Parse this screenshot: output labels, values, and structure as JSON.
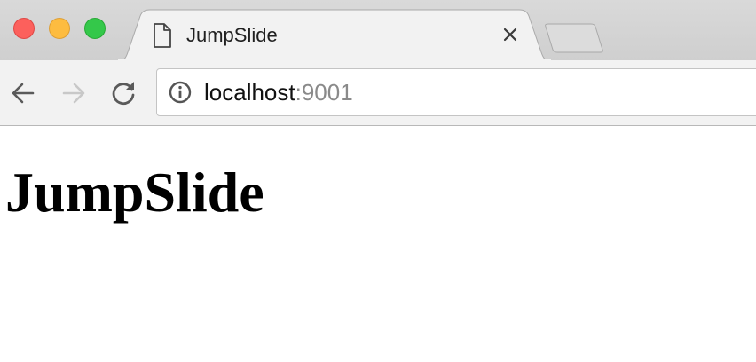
{
  "browser": {
    "tab": {
      "title": "JumpSlide",
      "icon": "document-icon",
      "close_icon": "close-icon"
    },
    "toolbar": {
      "back_icon": "arrow-left-icon",
      "forward_icon": "arrow-right-icon",
      "reload_icon": "reload-icon",
      "address": {
        "host": "localhost",
        "port": ":9001",
        "security_icon": "info-icon"
      }
    }
  },
  "page": {
    "heading": "JumpSlide"
  },
  "colors": {
    "close": "#fc605c",
    "minimize": "#fdbc40",
    "maximize": "#34c84a",
    "tabstrip": "#d4d4d4",
    "toolbar": "#f2f2f2",
    "port_text": "#8a8a8a"
  }
}
